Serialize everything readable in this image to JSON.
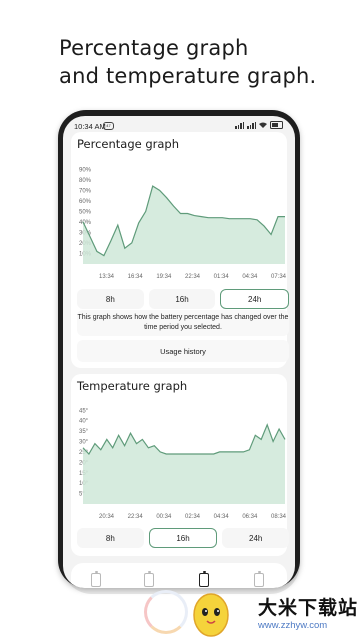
{
  "headline": {
    "line1": "Percentage graph",
    "line2": "and temperature graph."
  },
  "statusbar": {
    "time": "10:34 AM",
    "badge": "47"
  },
  "percentage_card": {
    "title": "Percentage graph",
    "y_ticks": [
      "90%",
      "80%",
      "70%",
      "60%",
      "50%",
      "40%",
      "30%",
      "20%",
      "10%"
    ],
    "x_ticks": [
      "13:34",
      "16:34",
      "19:34",
      "22:34",
      "01:34",
      "04:34",
      "07:34"
    ],
    "ranges": [
      "8h",
      "16h",
      "24h"
    ],
    "selected_range": "24h",
    "description": "This graph shows how the battery percentage has changed over the time period you selected.",
    "usage_button": "Usage history"
  },
  "temperature_card": {
    "title": "Temperature graph",
    "y_ticks": [
      "45°",
      "40°",
      "35°",
      "30°",
      "25°",
      "20°",
      "15°",
      "10°",
      "5°"
    ],
    "x_ticks": [
      "20:34",
      "22:34",
      "00:34",
      "02:34",
      "04:34",
      "06:34",
      "08:34"
    ],
    "ranges": [
      "8h",
      "16h",
      "24h"
    ],
    "selected_range": "16h"
  },
  "tabs": [
    "battery-outline-icon",
    "battery-status-icon",
    "battery-charging-icon",
    "battery-history-icon"
  ],
  "watermark": {
    "text": "大米下载站",
    "url": "www.zzhyw.com"
  },
  "colors": {
    "accent": "#5f9b7a",
    "fill": "#cfe7d8"
  },
  "chart_data": [
    {
      "type": "area",
      "title": "Percentage graph",
      "x": [
        "13:34",
        "16:34",
        "19:34",
        "22:34",
        "01:34",
        "04:34",
        "07:34"
      ],
      "ylabel": "",
      "xlabel": "",
      "ylim": [
        0,
        95
      ],
      "grid": false,
      "series": [
        {
          "values": [
            40,
            26,
            12,
            8,
            22,
            37,
            15,
            20,
            39,
            50,
            74,
            70,
            63,
            55,
            48,
            48,
            46,
            45,
            44,
            44,
            44,
            43,
            43,
            43,
            43,
            42,
            36,
            28,
            45,
            45
          ]
        }
      ]
    },
    {
      "type": "area",
      "title": "Temperature graph",
      "x": [
        "20:34",
        "22:34",
        "00:34",
        "02:34",
        "04:34",
        "06:34",
        "08:34"
      ],
      "ylabel": "",
      "xlabel": "",
      "ylim": [
        0,
        48
      ],
      "grid": false,
      "series": [
        {
          "values": [
            27,
            24,
            29,
            26,
            31,
            27,
            33,
            28,
            34,
            29,
            31,
            27,
            28,
            25,
            24,
            24,
            24,
            24,
            24,
            24,
            24,
            24,
            24,
            25,
            25,
            25,
            25,
            25,
            26,
            33,
            31,
            38,
            30,
            36,
            31
          ]
        }
      ]
    }
  ]
}
